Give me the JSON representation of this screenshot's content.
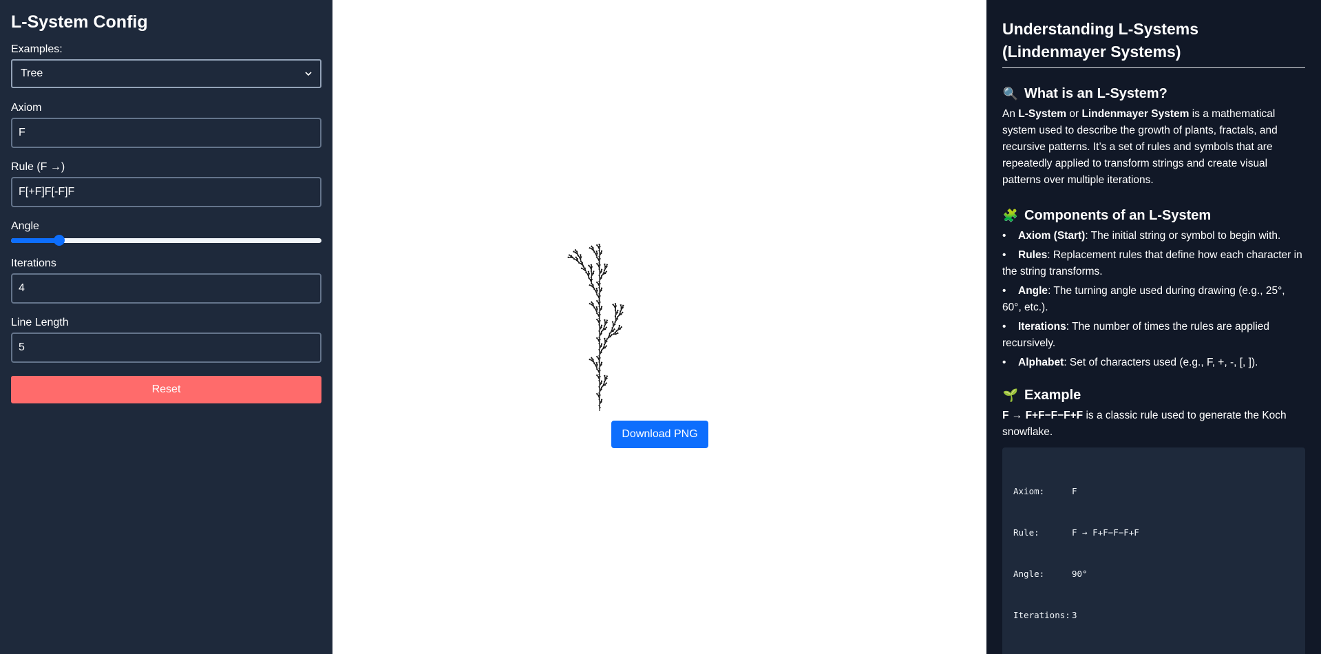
{
  "config": {
    "title": "L-System Config",
    "examples_label": "Examples:",
    "examples_value": "Tree",
    "axiom_label": "Axiom",
    "axiom_value": "F",
    "rule_label": "Rule (F →)",
    "rule_value": "F[+F]F[-F]F",
    "angle_label": "Angle",
    "angle_fraction": 0.155,
    "iterations_label": "Iterations",
    "iterations_value": "4",
    "line_length_label": "Line Length",
    "line_length_value": "5",
    "reset_label": "Reset"
  },
  "canvas": {
    "download_label": "Download PNG"
  },
  "info": {
    "title": "Understanding L-Systems (Lindenmayer Systems)",
    "what_heading": "What is an L-System?",
    "what_icon": "magnifier-icon",
    "what_text_1": "An ",
    "what_bold_1": "L-System",
    "what_text_2": " or ",
    "what_bold_2": "Lindenmayer System",
    "what_text_3": " is a mathematical system used to describe the growth of plants, fractals, and recursive patterns. It’s a set of rules and symbols that are repeatedly applied to transform strings and create visual patterns over multiple iterations.",
    "components_heading": "Components of an L-System",
    "components_icon": "puzzle-icon",
    "components": [
      {
        "term": "Axiom (Start)",
        "desc": ": The initial string or symbol to begin with."
      },
      {
        "term": "Rules",
        "desc": ": Replacement rules that define how each character in the string transforms."
      },
      {
        "term": "Angle",
        "desc": ": The turning angle used during drawing (e.g., 25°, 60°, etc.)."
      },
      {
        "term": "Iterations",
        "desc": ": The number of times the rules are applied recursively."
      },
      {
        "term": "Alphabet",
        "desc": ": Set of characters used (e.g., F, +, -, [, ])."
      }
    ],
    "example_heading": "Example",
    "example_icon": "seedling-icon",
    "example_bold": "F → F+F−F−F+F",
    "example_text": " is a classic rule used to generate the Koch snowflake.",
    "code": [
      {
        "key": "Axiom:",
        "value": "F"
      },
      {
        "key": "Rule:",
        "value": "F → F+F−F−F+F"
      },
      {
        "key": "Angle:",
        "value": "90°"
      },
      {
        "key": "Iterations:",
        "value": "3"
      }
    ]
  }
}
